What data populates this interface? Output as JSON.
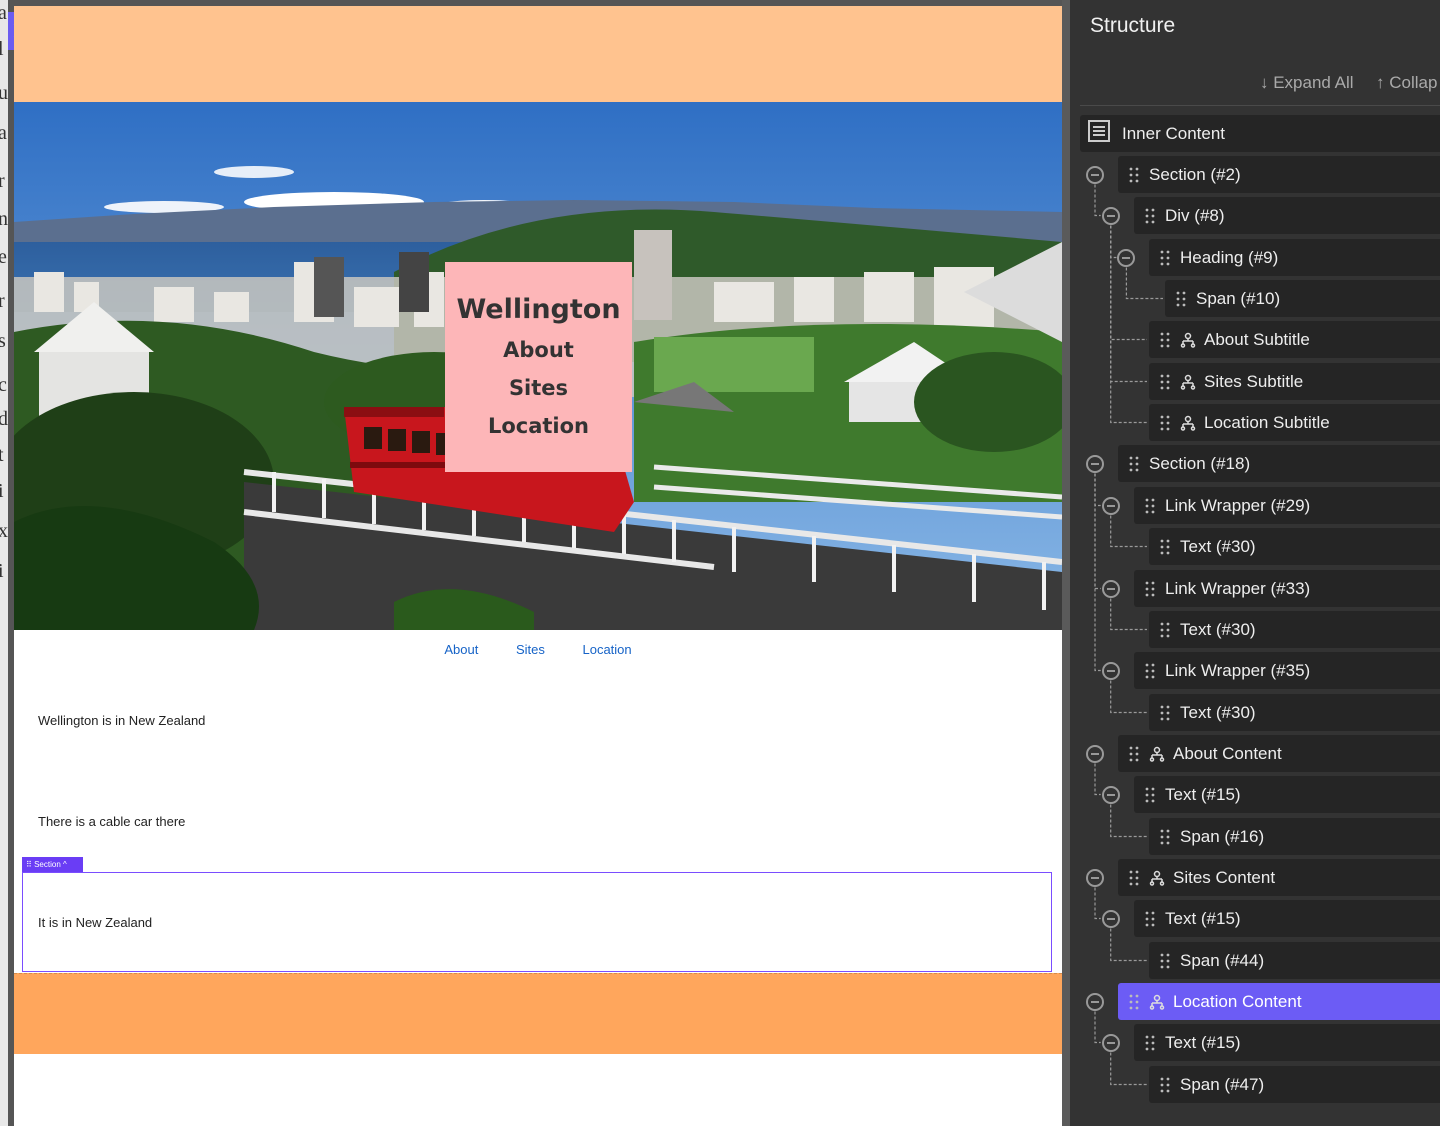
{
  "left_strip_glyphs": [
    "a",
    "l",
    "u",
    "a",
    "r",
    "n",
    "e",
    "r",
    "s",
    "c",
    "d",
    "t",
    "i",
    "x",
    "i"
  ],
  "toggle_glyph": "⟩",
  "hero": {
    "heading": "Wellington",
    "subtitles": [
      "About",
      "Sites",
      "Location"
    ]
  },
  "nav": {
    "items": [
      "About",
      "Sites",
      "Location"
    ]
  },
  "content": {
    "about_text": "Wellington is in New Zealand",
    "sites_text": "There is a cable car there",
    "location_text": "It is in New Zealand"
  },
  "section_tag": {
    "label": "Section",
    "chevron": "^"
  },
  "colors": {
    "top_band": "#ffc38f",
    "footer_band": "#ffa65c",
    "title_box": "#fdb6b8",
    "accent": "#6c5cf5",
    "link": "#1663c7"
  },
  "panel": {
    "title": "Structure",
    "expand_all": "↓ Expand All",
    "collapse_all": "↑ Collap",
    "root": {
      "label": "Inner Content",
      "icon": "page-icon"
    },
    "items": [
      {
        "label": "Section (#2)",
        "depth": 0,
        "collapsible": true,
        "component": false
      },
      {
        "label": "Div (#8)",
        "depth": 1,
        "collapsible": true,
        "component": false
      },
      {
        "label": "Heading (#9)",
        "depth": 2,
        "collapsible": true,
        "component": false
      },
      {
        "label": "Span (#10)",
        "depth": 3,
        "collapsible": false,
        "component": false
      },
      {
        "label": "About Subtitle",
        "depth": 2,
        "collapsible": false,
        "component": true
      },
      {
        "label": "Sites Subtitle",
        "depth": 2,
        "collapsible": false,
        "component": true
      },
      {
        "label": "Location Subtitle",
        "depth": 2,
        "collapsible": false,
        "component": true
      },
      {
        "label": "Section (#18)",
        "depth": 0,
        "collapsible": true,
        "component": false
      },
      {
        "label": "Link Wrapper (#29)",
        "depth": 1,
        "collapsible": true,
        "component": false
      },
      {
        "label": "Text (#30)",
        "depth": 2,
        "collapsible": false,
        "component": false
      },
      {
        "label": "Link Wrapper (#33)",
        "depth": 1,
        "collapsible": true,
        "component": false
      },
      {
        "label": "Text (#30)",
        "depth": 2,
        "collapsible": false,
        "component": false
      },
      {
        "label": "Link Wrapper (#35)",
        "depth": 1,
        "collapsible": true,
        "component": false
      },
      {
        "label": "Text (#30)",
        "depth": 2,
        "collapsible": false,
        "component": false
      },
      {
        "label": "About Content",
        "depth": 0,
        "collapsible": true,
        "component": true
      },
      {
        "label": "Text (#15)",
        "depth": 1,
        "collapsible": true,
        "component": false
      },
      {
        "label": "Span (#16)",
        "depth": 2,
        "collapsible": false,
        "component": false
      },
      {
        "label": "Sites Content",
        "depth": 0,
        "collapsible": true,
        "component": true
      },
      {
        "label": "Text (#15)",
        "depth": 1,
        "collapsible": true,
        "component": false
      },
      {
        "label": "Span (#44)",
        "depth": 2,
        "collapsible": false,
        "component": false
      },
      {
        "label": "Location Content",
        "depth": 0,
        "collapsible": true,
        "component": true,
        "selected": true
      },
      {
        "label": "Text (#15)",
        "depth": 1,
        "collapsible": true,
        "component": false
      },
      {
        "label": "Span (#47)",
        "depth": 2,
        "collapsible": false,
        "component": false
      }
    ]
  }
}
